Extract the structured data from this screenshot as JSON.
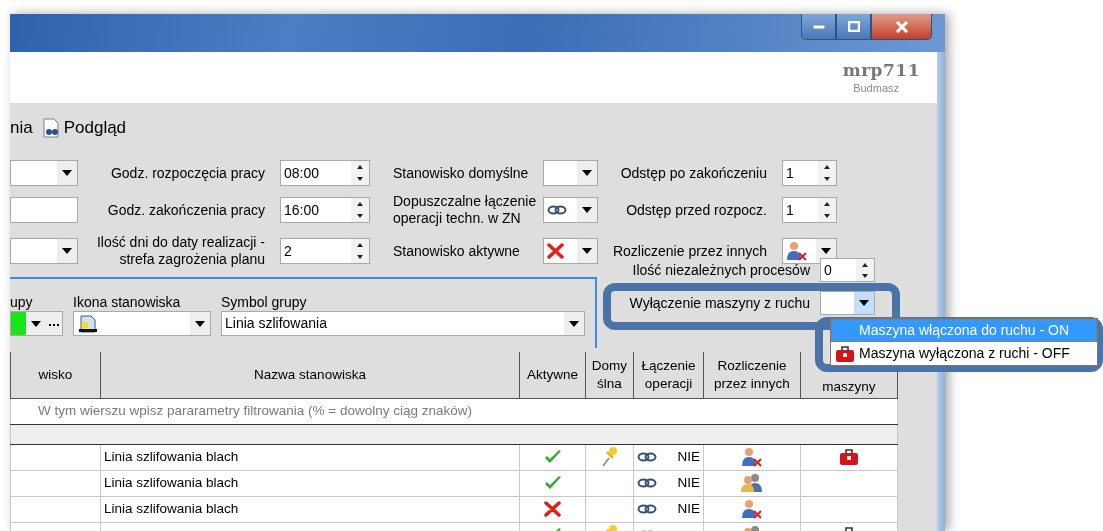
{
  "header": {
    "brand": "mrp711",
    "company": "Budmasz"
  },
  "toolbar": [
    {
      "label": "nia"
    },
    {
      "label": "Podgląd"
    }
  ],
  "form": {
    "left_fields": [
      {
        "kind": "combo"
      },
      {
        "kind": "text"
      },
      {
        "kind": "combo"
      }
    ],
    "time_fields": [
      {
        "label": "Godz. rozpoczęcia pracy",
        "value": "08:00"
      },
      {
        "label": "Godz. zakończenia pracy",
        "value": "16:00"
      },
      {
        "label": "Ilość dni do daty realizacji - strefa zagrożenia planu",
        "value": "2"
      }
    ],
    "options": [
      {
        "label": "Stanowisko domyślne",
        "kind": "blank"
      },
      {
        "label": "Dopuszczalne łączenie operacji techn. w ZN",
        "kind": "link"
      },
      {
        "label": "Stanowisko aktywne",
        "kind": "toggle",
        "on": false
      }
    ],
    "spacing": [
      {
        "label": "Odstęp po zakończeniu",
        "kind": "spinner",
        "value": "1"
      },
      {
        "label": "Odstęp przed rozpocz.",
        "kind": "spinner",
        "value": "1"
      },
      {
        "label": "Rozliczenie przez innych",
        "kind": "combo",
        "by_others": false
      }
    ],
    "extra": [
      {
        "label": "Ilość niezależnych procesów",
        "kind": "spinner",
        "value": "0"
      },
      {
        "label": "Wyłączenie maszyny z ruchu",
        "kind": "combo",
        "expanded": true,
        "options": [
          {
            "label": "Maszyna włączona do ruchu - ON",
            "machine_off": false,
            "selected": true
          },
          {
            "label": "Maszyna wyłączona z ruchi - OFF",
            "machine_off": true,
            "selected": false
          }
        ]
      }
    ]
  },
  "group": [
    {
      "label": "upy",
      "kind": "color",
      "color": "#19e619"
    },
    {
      "label": "Ikona stanowiska",
      "kind": "icon"
    },
    {
      "label": "Symbol grupy",
      "kind": "text",
      "value": "Linia szlifowania"
    }
  ],
  "table": {
    "columns": [
      "wisko",
      "Nazwa stanowiska",
      "Aktywne",
      "Domy ślna",
      "Łączenie operacji",
      "Rozliczenie przez innych",
      "maszyny"
    ],
    "filter_hint": "W tym wierszu wpisz pararametry filtrowania (% = dowolny ciąg znaków)",
    "rows": [
      {
        "name": "Linia szlifowania blach",
        "active": true,
        "default": true,
        "linking": "NIE",
        "by_others": false,
        "machine_off": true
      },
      {
        "name": "Linia szlifowania blach",
        "active": true,
        "default": false,
        "linking": "NIE",
        "by_others": true,
        "machine_off": false
      },
      {
        "name": "Linia szlifowania blach",
        "active": false,
        "default": false,
        "linking": "NIE",
        "by_others": false,
        "machine_off": false
      },
      {
        "active": true,
        "default": true,
        "by_others": true,
        "machine_off": true
      }
    ]
  }
}
